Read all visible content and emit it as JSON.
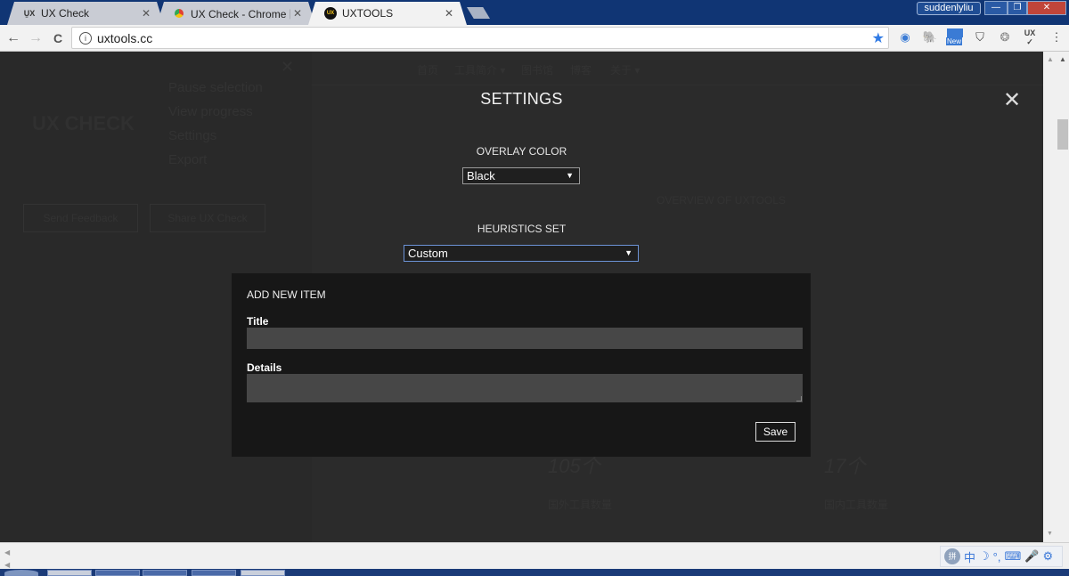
{
  "browser": {
    "tabs": [
      {
        "label": "UX Check",
        "icon": "ux-check-icon",
        "active": false
      },
      {
        "label": "UX Check - Chrome 网...",
        "icon": "chrome-webstore-icon",
        "active": false
      },
      {
        "label": "UXTOOLS",
        "icon": "uxtools-icon",
        "active": true
      }
    ],
    "user": "suddenlyliu",
    "window_controls": {
      "minimize": "—",
      "maximize": "❐",
      "close": "✕"
    },
    "address": {
      "url": "uxtools.cc",
      "info_icon": "i"
    },
    "nav": {
      "back": "←",
      "forward": "→",
      "reload": "C"
    },
    "extensions": [
      "star-bookmark-icon",
      "screenshot-extension-icon",
      "evernote-icon",
      "new-extension-icon",
      "pocket-icon",
      "openai-like-icon",
      "ux-check-icon",
      "menu-icon"
    ],
    "ext_new_badge": "New",
    "ux_ext_label": "UX"
  },
  "background": {
    "panel": {
      "title": "UX CHECK",
      "menu": [
        "Pause selection",
        "View progress",
        "Settings",
        "Export"
      ],
      "buttons": [
        "Send Feedback",
        "Share UX Check"
      ]
    },
    "nav": [
      "首页",
      "工具简介 ▾",
      "图书馆",
      "博客",
      "关于 ▾"
    ],
    "hero_subtitle": "OVERVIEW OF UXTOOLS",
    "stats": [
      {
        "value": "105个",
        "label": "国外工具数量"
      },
      {
        "value": "17个",
        "label": "国内工具数量"
      }
    ]
  },
  "modal": {
    "title": "SETTINGS",
    "close_icon": "✕",
    "overlay_color": {
      "label": "OVERLAY COLOR",
      "value": "Black"
    },
    "heuristics_set": {
      "label": "HEURISTICS SET",
      "value": "Custom"
    },
    "add_item": {
      "heading": "ADD NEW ITEM",
      "title_label": "Title",
      "title_value": "",
      "details_label": "Details",
      "details_value": "",
      "save_label": "Save"
    }
  },
  "ime_bar": {
    "lang": "中",
    "items": [
      "☽",
      "°,",
      "⌨",
      "🎤",
      "⚙"
    ],
    "logo": "拼"
  },
  "colors": {
    "tabstrip": "#103574",
    "page_bg": "#2b2b2b",
    "add_box_bg": "#171717",
    "input_bg": "#474747",
    "focus_border": "#6c93d6"
  }
}
